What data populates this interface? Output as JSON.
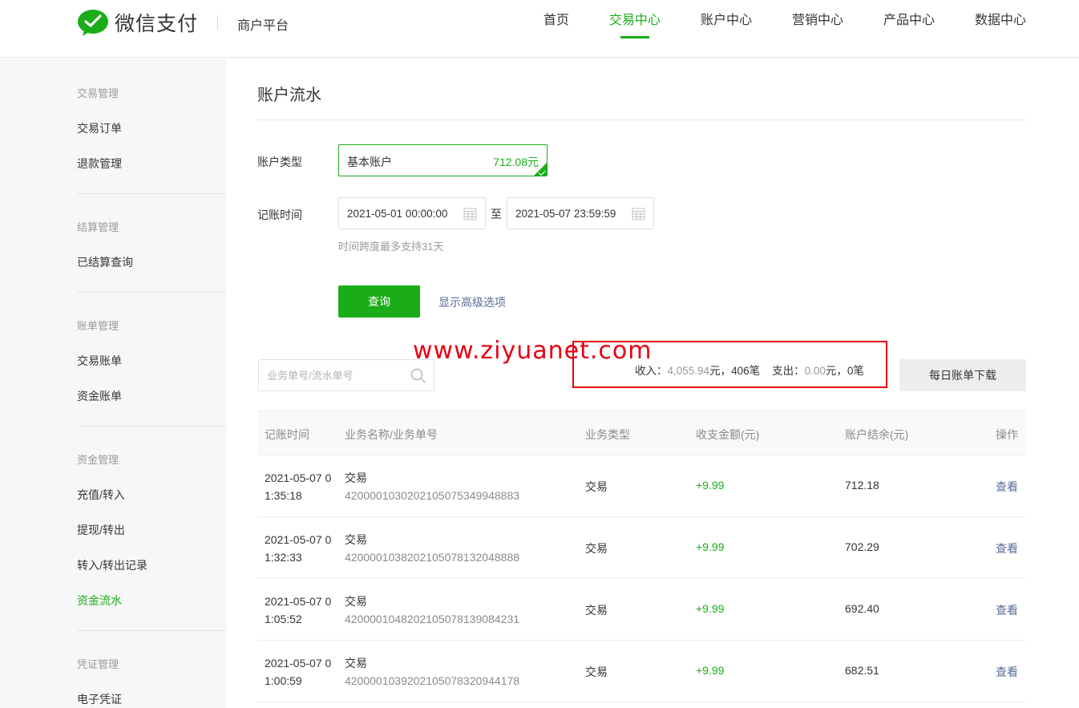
{
  "header": {
    "brand": "微信支付",
    "platform": "商户平台",
    "nav": [
      "首页",
      "交易中心",
      "账户中心",
      "营销中心",
      "产品中心",
      "数据中心"
    ],
    "active_nav": "交易中心",
    "brand_color": "#1aad19"
  },
  "sidebar": {
    "groups": [
      {
        "title": "交易管理",
        "items": [
          "交易订单",
          "退款管理"
        ]
      },
      {
        "title": "结算管理",
        "items": [
          "已结算查询"
        ]
      },
      {
        "title": "账单管理",
        "items": [
          "交易账单",
          "资金账单"
        ]
      },
      {
        "title": "资金管理",
        "items": [
          "充值/转入",
          "提现/转出",
          "转入/转出记录",
          "资金流水"
        ]
      },
      {
        "title": "凭证管理",
        "items": [
          "电子凭证"
        ]
      }
    ],
    "active_item": "资金流水"
  },
  "main": {
    "title": "账户流水",
    "account_type_label": "账户类型",
    "account_name": "基本账户",
    "account_amount": "712.08元",
    "time_label": "记账时间",
    "date_start": "2021-05-01 00:00:00",
    "date_sep": "至",
    "date_end": "2021-05-07 23:59:59",
    "hint": "时间跨度最多支持31天",
    "query_button": "查询",
    "advanced_link": "显示高级选项",
    "watermark": "www.ziyuanet.com",
    "search_placeholder": "业务单号/流水单号",
    "summary": {
      "income_label": "收入：",
      "income_amount": "4,055.94",
      "income_unit": "元，",
      "income_count": "406笔",
      "expense_label": "支出：",
      "expense_amount": "0.00",
      "expense_unit": "元，",
      "expense_count": "0笔"
    },
    "download_button": "每日账单下载"
  },
  "table": {
    "columns": [
      "记账时间",
      "业务名称/业务单号",
      "业务类型",
      "收支金额(元)",
      "账户结余(元)",
      "操作"
    ],
    "rows": [
      {
        "time": "2021-05-07 01:35:18",
        "name": "交易",
        "no": "4200001030202105075349948883",
        "type": "交易",
        "amount": "+9.99",
        "balance": "712.18",
        "action": "查看"
      },
      {
        "time": "2021-05-07 01:32:33",
        "name": "交易",
        "no": "4200001038202105078132048888",
        "type": "交易",
        "amount": "+9.99",
        "balance": "702.29",
        "action": "查看"
      },
      {
        "time": "2021-05-07 01:05:52",
        "name": "交易",
        "no": "4200001048202105078139084231",
        "type": "交易",
        "amount": "+9.99",
        "balance": "692.40",
        "action": "查看"
      },
      {
        "time": "2021-05-07 01:00:59",
        "name": "交易",
        "no": "4200001039202105078320944178",
        "type": "交易",
        "amount": "+9.99",
        "balance": "682.51",
        "action": "查看"
      }
    ]
  }
}
